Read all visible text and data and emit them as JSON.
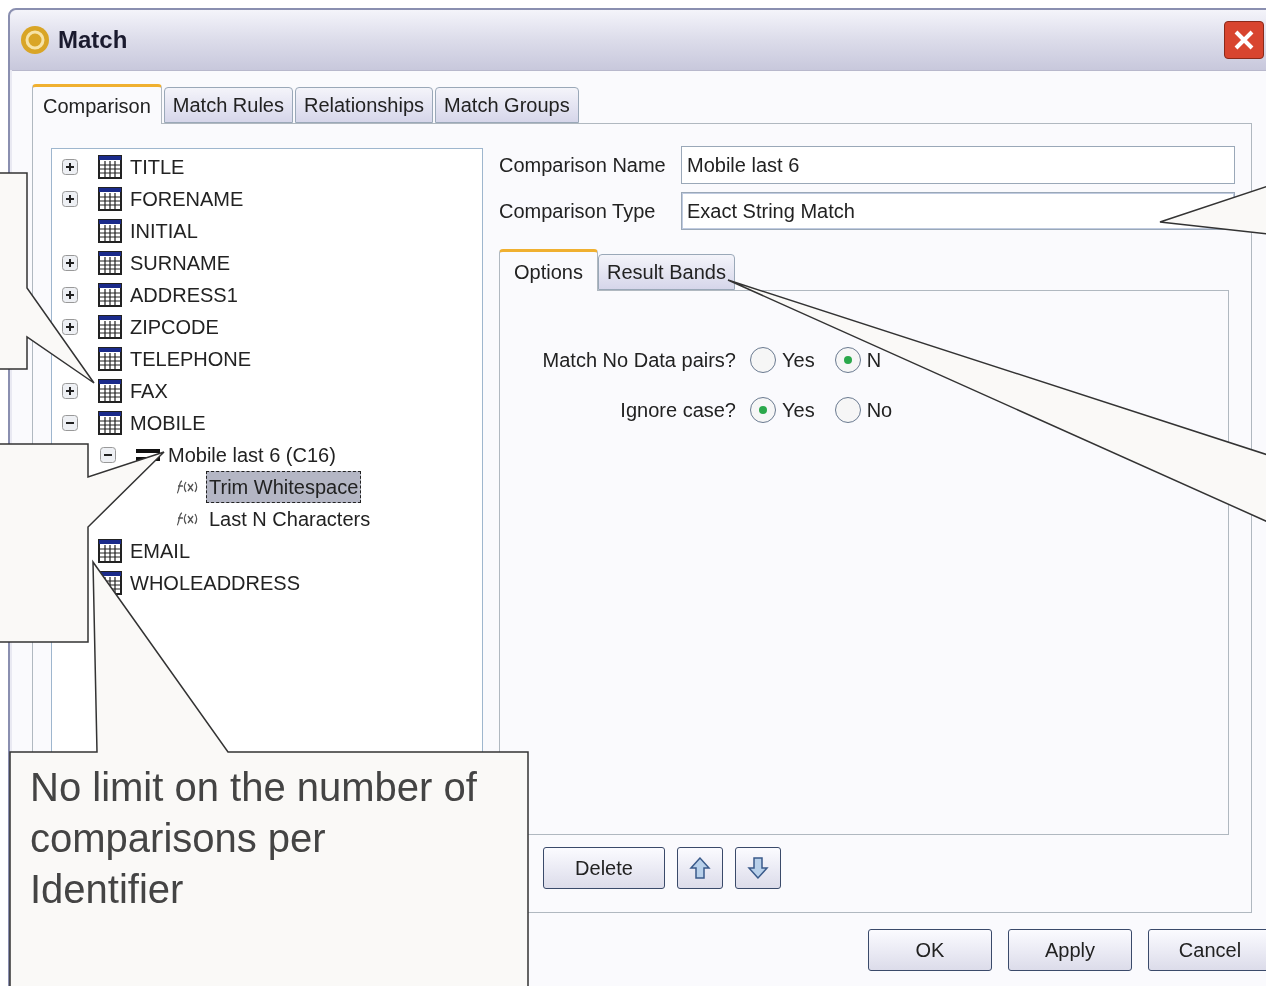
{
  "window": {
    "title": "Match"
  },
  "tabs": [
    {
      "label": "Comparison",
      "selected": true
    },
    {
      "label": "Match Rules",
      "selected": false
    },
    {
      "label": "Relationships",
      "selected": false
    },
    {
      "label": "Match Groups",
      "selected": false
    }
  ],
  "tree": [
    {
      "kind": "field",
      "label": "TITLE",
      "expanded": false
    },
    {
      "kind": "field",
      "label": "FORENAME",
      "expanded": false
    },
    {
      "kind": "field",
      "label": "INITIAL"
    },
    {
      "kind": "field",
      "label": "SURNAME",
      "expanded": false
    },
    {
      "kind": "field",
      "label": "ADDRESS1",
      "expanded": false
    },
    {
      "kind": "field",
      "label": "ZIPCODE",
      "expanded": false
    },
    {
      "kind": "field",
      "label": "TELEPHONE"
    },
    {
      "kind": "field",
      "label": "FAX",
      "expanded": false
    },
    {
      "kind": "field",
      "label": "MOBILE",
      "expanded": true,
      "children": [
        {
          "kind": "comparison",
          "label": "Mobile last 6 (C16)",
          "expanded": true,
          "children": [
            {
              "kind": "function",
              "label": "Trim Whitespace",
              "selected": true
            },
            {
              "kind": "function",
              "label": "Last N Characters",
              "selected": false
            }
          ]
        }
      ]
    },
    {
      "kind": "field",
      "label": "EMAIL"
    },
    {
      "kind": "field",
      "label": "WHOLEADDRESS"
    }
  ],
  "form": [
    {
      "label": "Comparison Name",
      "value": "Mobile last 6",
      "kind": "text"
    },
    {
      "label": "Comparison Type",
      "value": "Exact String Match",
      "kind": "dropdown"
    }
  ],
  "inner_tabs": [
    {
      "label": "Options",
      "selected": true
    },
    {
      "label": "Result Bands",
      "selected": false
    }
  ],
  "options": [
    {
      "label": "Match No Data pairs?",
      "choices": [
        {
          "label": "Yes",
          "selected": false
        },
        {
          "label": "N",
          "selected": true
        }
      ]
    },
    {
      "label": "Ignore case?",
      "choices": [
        {
          "label": "Yes",
          "selected": true
        },
        {
          "label": "No",
          "selected": false
        }
      ]
    }
  ],
  "list_buttons": [
    "Delete"
  ],
  "dialog_buttons": [
    "OK",
    "Apply",
    "Cancel"
  ],
  "callout_text": "No limit on the number of comparisons per Identifier"
}
